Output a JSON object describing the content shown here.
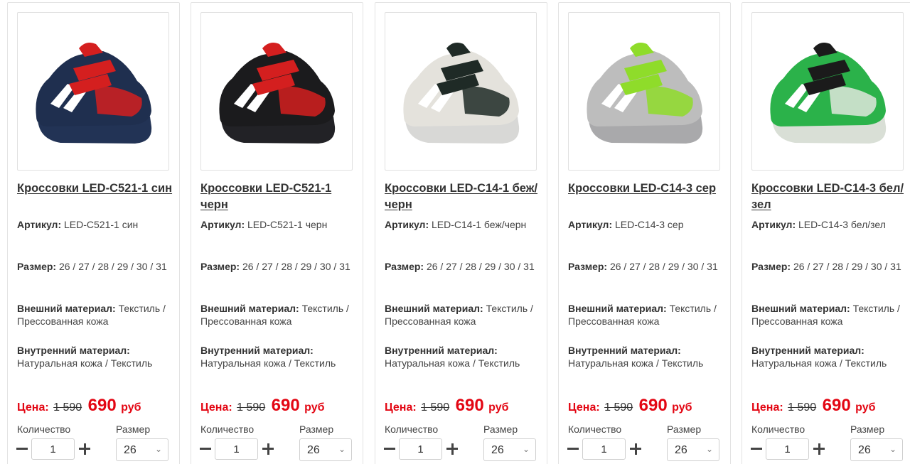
{
  "products": [
    {
      "title": "Кроссовки LED-C521-1 син",
      "article_label": "Артикул:",
      "article": "LED-C521-1 син",
      "size_label": "Размер:",
      "sizes": "26 / 27 / 28 / 29 / 30 / 31",
      "outer_label": "Внешний материал:",
      "outer": "Текстиль / Прессованная кожа",
      "inner_label": "Внутренний материал:",
      "inner": "Натуральная кожа / Текстиль",
      "price_label": "Цена:",
      "old_price": "1 590",
      "new_price": "690",
      "currency": "руб",
      "qty_label": "Количество",
      "qty": "1",
      "size_select_label": "Размер",
      "size_selected": "26",
      "image": "sneaker-navy-red-grow",
      "colors": {
        "main": "#1f2f4f",
        "accent": "#d41f1f",
        "sole": "#223355"
      }
    },
    {
      "title": "Кроссовки LED-C521-1 черн",
      "article_label": "Артикул:",
      "article": "LED-C521-1 черн",
      "size_label": "Размер:",
      "sizes": "26 / 27 / 28 / 29 / 30 / 31",
      "outer_label": "Внешний материал:",
      "outer": "Текстиль / Прессованная кожа",
      "inner_label": "Внутренний материал:",
      "inner": "Натуральная кожа / Текстиль",
      "price_label": "Цена:",
      "old_price": "1 590",
      "new_price": "690",
      "currency": "руб",
      "qty_label": "Количество",
      "qty": "1",
      "size_select_label": "Размер",
      "size_selected": "26",
      "image": "sneaker-black-red-grow",
      "colors": {
        "main": "#1b1b1d",
        "accent": "#d41f1f",
        "sole": "#222226"
      }
    },
    {
      "title": "Кроссовки LED-C14-1 беж/черн",
      "article_label": "Артикул:",
      "article": "LED-C14-1 беж/черн",
      "size_label": "Размер:",
      "sizes": "26 / 27 / 28 / 29 / 30 / 31",
      "outer_label": "Внешний материал:",
      "outer": "Текстиль / Прессованная кожа",
      "inner_label": "Внутренний материал:",
      "inner": "Натуральная кожа / Текстиль",
      "price_label": "Цена:",
      "old_price": "1 590",
      "new_price": "690",
      "currency": "руб",
      "qty_label": "Количество",
      "qty": "1",
      "size_select_label": "Размер",
      "size_selected": "26",
      "image": "sneaker-beige-black-fashion",
      "colors": {
        "main": "#e4e2dc",
        "accent": "#1f2a26",
        "sole": "#d8d8d6"
      }
    },
    {
      "title": "Кроссовки LED-C14-3 сер",
      "article_label": "Артикул:",
      "article": "LED-C14-3 сер",
      "size_label": "Размер:",
      "sizes": "26 / 27 / 28 / 29 / 30 / 31",
      "outer_label": "Внешний материал:",
      "outer": "Текстиль / Прессованная кожа",
      "inner_label": "Внутренний материал:",
      "inner": "Натуральная кожа / Текстиль",
      "price_label": "Цена:",
      "old_price": "1 590",
      "new_price": "690",
      "currency": "руб",
      "qty_label": "Количество",
      "qty": "1",
      "size_select_label": "Размер",
      "size_selected": "26",
      "image": "sneaker-grey-fashion",
      "colors": {
        "main": "#bdbdbd",
        "accent": "#8fdc2a",
        "sole": "#a9a9ab"
      }
    },
    {
      "title": "Кроссовки LED-C14-3 бел/зел",
      "article_label": "Артикул:",
      "article": "LED-C14-3 бел/зел",
      "size_label": "Размер:",
      "sizes": "26 / 27 / 28 / 29 / 30 / 31",
      "outer_label": "Внешний материал:",
      "outer": "Текстиль / Прессованная кожа",
      "inner_label": "Внутренний материал:",
      "inner": "Натуральная кожа / Текстиль",
      "price_label": "Цена:",
      "old_price": "1 590",
      "new_price": "690",
      "currency": "руб",
      "qty_label": "Количество",
      "qty": "1",
      "size_select_label": "Размер",
      "size_selected": "26",
      "image": "sneaker-white-green-fashion",
      "colors": {
        "main": "#2bb24a",
        "accent": "#1b1b1b",
        "sole": "#d9dfd6"
      }
    }
  ],
  "icons": {
    "minus": "minus-icon",
    "plus": "plus-icon",
    "dropdown": "chevron-down-icon"
  },
  "brand_colors": {
    "price_red": "#e30613",
    "text": "#333333",
    "border": "#e3e3e3"
  }
}
